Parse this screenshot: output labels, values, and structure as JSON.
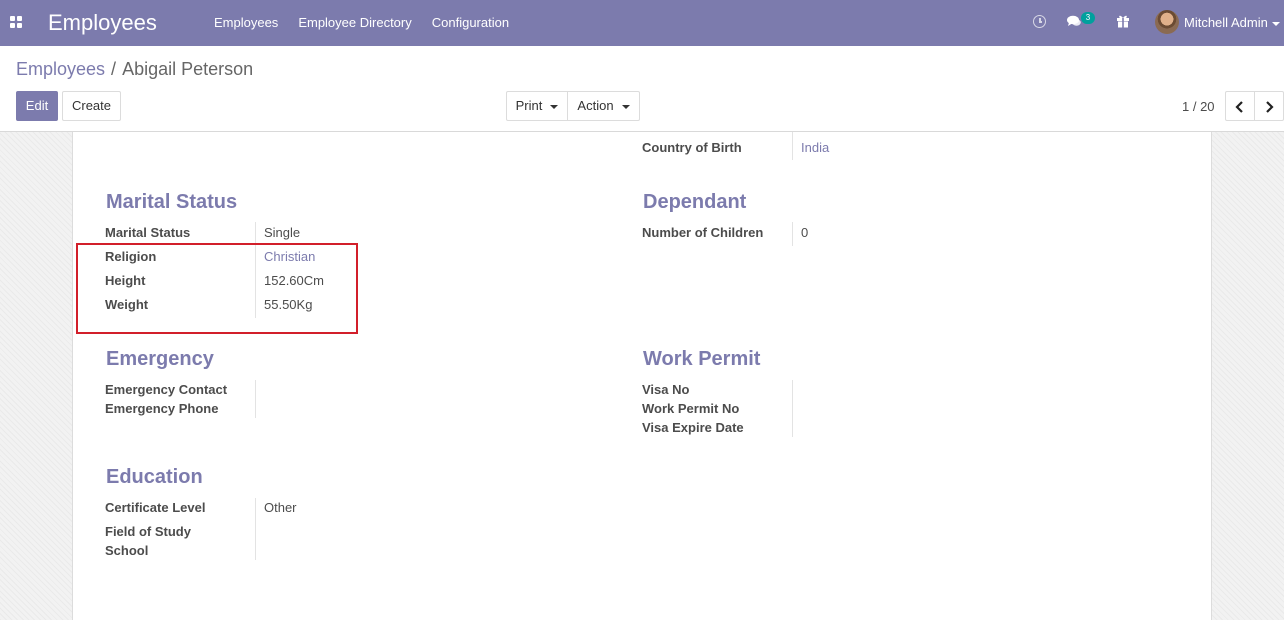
{
  "navbar": {
    "app_title": "Employees",
    "menu": [
      "Employees",
      "Employee Directory",
      "Configuration"
    ],
    "message_count": "3",
    "user_name": "Mitchell Admin",
    "icons": [
      "apps-grid-icon",
      "clock-icon",
      "chat-icon",
      "gift-icon"
    ]
  },
  "breadcrumb": {
    "parent": "Employees",
    "separator": "/",
    "current": "Abigail Peterson"
  },
  "buttons": {
    "edit": "Edit",
    "create": "Create",
    "print": "Print",
    "action": "Action"
  },
  "pager": {
    "value": "1 / 20"
  },
  "form": {
    "country_of_birth": {
      "label": "Country of Birth",
      "value": "India"
    },
    "marital": {
      "title": "Marital Status",
      "fields": [
        {
          "label": "Marital Status",
          "value": "Single"
        },
        {
          "label": "Religion",
          "value": "Christian"
        },
        {
          "label": "Height",
          "value": "152.60Cm"
        },
        {
          "label": "Weight",
          "value": "55.50Kg"
        }
      ]
    },
    "dependant": {
      "title": "Dependant",
      "fields": [
        {
          "label": "Number of Children",
          "value": "0"
        }
      ]
    },
    "emergency": {
      "title": "Emergency",
      "fields": [
        {
          "label": "Emergency Contact",
          "value": ""
        },
        {
          "label": "Emergency Phone",
          "value": ""
        }
      ]
    },
    "work_permit": {
      "title": "Work Permit",
      "fields": [
        {
          "label": "Visa No",
          "value": ""
        },
        {
          "label": "Work Permit No",
          "value": ""
        },
        {
          "label": "Visa Expire Date",
          "value": ""
        }
      ]
    },
    "education": {
      "title": "Education",
      "fields": [
        {
          "label": "Certificate Level",
          "value": "Other"
        },
        {
          "label": "Field of Study",
          "value": ""
        },
        {
          "label": "School",
          "value": ""
        }
      ]
    }
  },
  "colors": {
    "brand": "#7c7bad",
    "badge": "#00a09d",
    "highlight": "#d21f2a"
  }
}
